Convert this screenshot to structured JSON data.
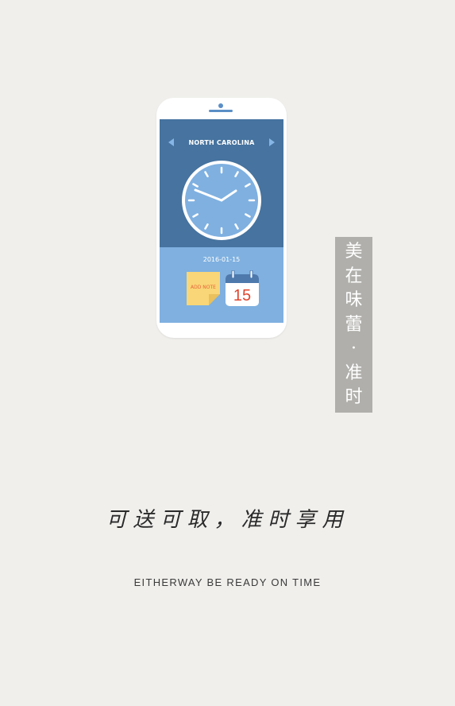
{
  "phone": {
    "city": "NORTH CAROLINA",
    "date": "2016-01-15",
    "note_label": "ADD NOTE",
    "calendar_day": "15",
    "icons": [
      "arrow-left-icon",
      "arrow-right-icon",
      "clock-icon",
      "note-icon",
      "calendar-icon"
    ],
    "clock_time": "10:10"
  },
  "badge": {
    "chars": [
      "美",
      "在",
      "味",
      "蕾",
      "·",
      "准",
      "时"
    ]
  },
  "slogan": "可送可取，准时享用",
  "tagline": "EITHERWAY BE READY ON TIME",
  "colors": {
    "background": "#f0efec",
    "screen_top": "#46739f",
    "screen_bottom": "#7fb0e0",
    "clock_face": "#7fb0e0",
    "note": "#f9d677",
    "note_text": "#e8643a",
    "calendar_header": "#4d79ad",
    "calendar_day": "#e0452e",
    "badge": "#b0afab"
  }
}
